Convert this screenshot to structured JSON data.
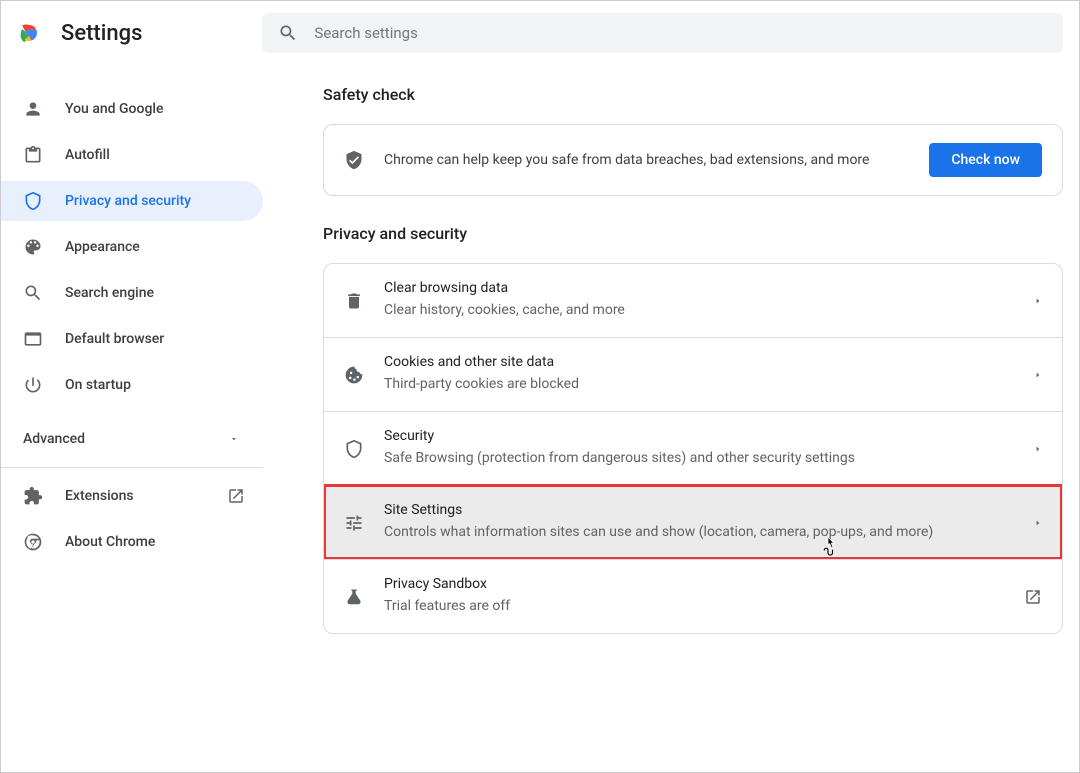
{
  "header": {
    "title": "Settings",
    "search_placeholder": "Search settings"
  },
  "sidebar": {
    "items": [
      {
        "label": "You and Google"
      },
      {
        "label": "Autofill"
      },
      {
        "label": "Privacy and security"
      },
      {
        "label": "Appearance"
      },
      {
        "label": "Search engine"
      },
      {
        "label": "Default browser"
      },
      {
        "label": "On startup"
      }
    ],
    "advanced_label": "Advanced",
    "extensions_label": "Extensions",
    "about_label": "About Chrome"
  },
  "safety": {
    "section_title": "Safety check",
    "text": "Chrome can help keep you safe from data breaches, bad extensions, and more",
    "button": "Check now"
  },
  "privacy": {
    "section_title": "Privacy and security",
    "items": [
      {
        "title": "Clear browsing data",
        "sub": "Clear history, cookies, cache, and more"
      },
      {
        "title": "Cookies and other site data",
        "sub": "Third-party cookies are blocked"
      },
      {
        "title": "Security",
        "sub": "Safe Browsing (protection from dangerous sites) and other security settings"
      },
      {
        "title": "Site Settings",
        "sub": "Controls what information sites can use and show (location, camera, pop-ups, and more)"
      },
      {
        "title": "Privacy Sandbox",
        "sub": "Trial features are off"
      }
    ]
  }
}
